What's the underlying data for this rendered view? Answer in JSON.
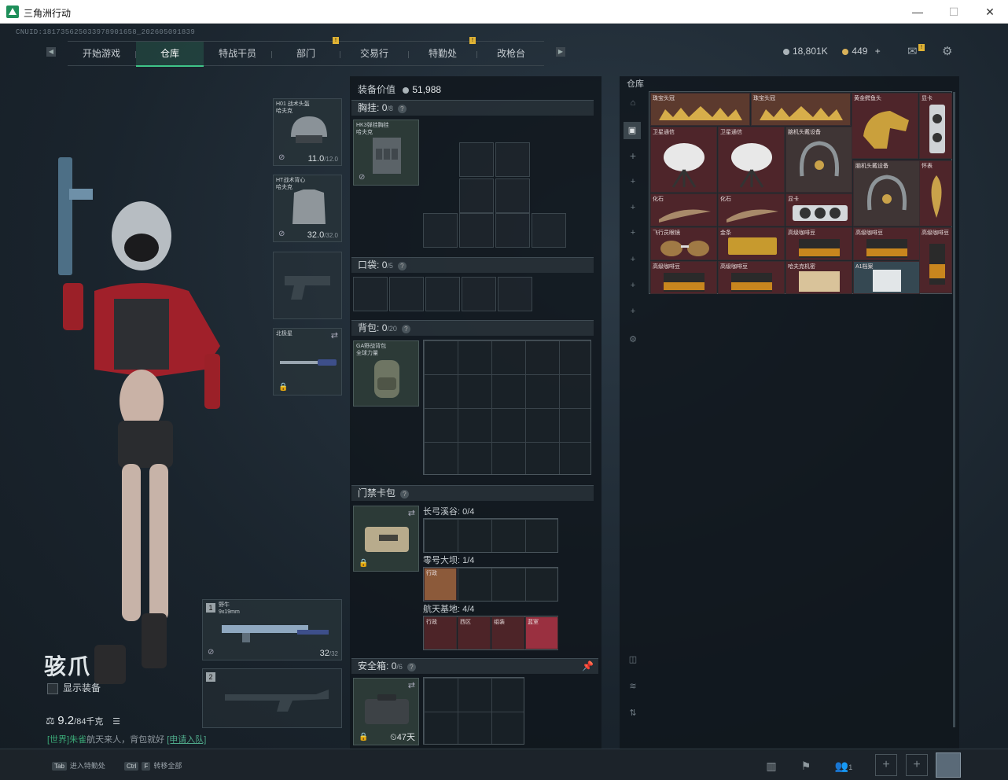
{
  "window": {
    "title": "三角洲行动",
    "minimize": "—",
    "maximize": "☐",
    "close": "✕"
  },
  "header": {
    "uid": "CNUID:1817356250339789016​58_202605091839",
    "tabs": [
      {
        "label": "开始游戏",
        "active": false
      },
      {
        "label": "仓库",
        "active": true
      },
      {
        "label": "特战干员",
        "active": false
      },
      {
        "label": "部门",
        "active": false
      },
      {
        "label": "交易行",
        "active": false
      },
      {
        "label": "特勤处",
        "active": false
      },
      {
        "label": "改枪台",
        "active": false
      }
    ],
    "tab_prev_icon": "◀",
    "tab_next_icon": "▶",
    "badge_glyph": "!",
    "currency": {
      "hafcoin": "18,801K",
      "bonds": "449",
      "add": "+"
    },
    "mail_icon": "✉",
    "settings_icon": "⚙"
  },
  "character": {
    "name": "骇爪",
    "show_equipment": "显示装备",
    "weight": "9.2",
    "weight_max": "/84千克"
  },
  "chat": {
    "channel": "[世界]",
    "user": "朱雀",
    "message": "航天来人，背包就好",
    "apply": "[申请入队]"
  },
  "equipment": {
    "helmet": {
      "name": "H01 战术头盔\n哈夫克",
      "durability": "11.0",
      "max": "/12.0"
    },
    "armor": {
      "name": "HT战术背心\n哈夫克",
      "durability": "32.0",
      "max": "/32.0"
    },
    "melee": {
      "name": "北极星"
    },
    "weapon1": {
      "slot": "1",
      "name": "野牛\n9x19mm",
      "ammo": "32",
      "ammo_max": "/32"
    },
    "weapon2": {
      "slot": "2"
    }
  },
  "loadout": {
    "value_label": "装备价值",
    "value": "51,988",
    "chest": {
      "label": "胸挂:",
      "count": "0",
      "max": "/8",
      "item": "HK3弹挂胸挂\n哈夫克"
    },
    "pocket": {
      "label": "口袋:",
      "count": "0",
      "max": "/5"
    },
    "backpack": {
      "label": "背包:",
      "count": "0",
      "max": "/20",
      "item": "GA野战背包\n全球力量"
    },
    "keycard": {
      "label": "门禁卡包",
      "maps": [
        {
          "name": "长弓溪谷:",
          "count": "0/4"
        },
        {
          "name": "零号大坝:",
          "count": "1/4"
        },
        {
          "name": "航天基地:",
          "count": "4/4"
        }
      ],
      "cards": [
        "行政",
        "西区",
        "组装",
        "蓝室"
      ],
      "dam_card": "行政"
    },
    "safebox": {
      "label": "安全箱:",
      "count": "0",
      "max": "/6",
      "days": "47天"
    }
  },
  "stash": {
    "title": "仓库",
    "items": [
      {
        "name": "珠宝头冠"
      },
      {
        "name": "珠宝头冠"
      },
      {
        "name": "黄金鳄鱼头"
      },
      {
        "name": "显卡"
      },
      {
        "name": "卫星通信"
      },
      {
        "name": "卫星通信"
      },
      {
        "name": "脑机头戴设备"
      },
      {
        "name": "脑机头戴设备"
      },
      {
        "name": "怀表"
      },
      {
        "name": "化石"
      },
      {
        "name": "化石"
      },
      {
        "name": "显卡"
      },
      {
        "name": "飞行员眼镜"
      },
      {
        "name": "金条"
      },
      {
        "name": "高级咖啡豆"
      },
      {
        "name": "高级咖啡豆"
      },
      {
        "name": "高级咖啡豆"
      },
      {
        "name": "高级咖啡豆"
      },
      {
        "name": "高级咖啡豆"
      },
      {
        "name": "哈夫克机密"
      },
      {
        "name": "A1档案"
      },
      {
        "name": "高级咖啡豆"
      }
    ]
  },
  "bottom": {
    "tab_key": "Tab",
    "tab_label": "进入特勤处",
    "ctrl_key": "Ctrl",
    "f_key": "F",
    "transfer_label": "转移全部",
    "squad_count": "1"
  }
}
